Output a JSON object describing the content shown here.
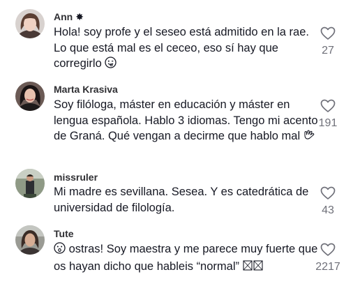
{
  "comments": [
    {
      "username": "Ann",
      "username_badge": "✸",
      "text": "Hola! soy profe y el seseo está admitido en la rae. Lo que está mal es el ceceo, eso sí hay que corregirlo",
      "trailing_emoji": "winking-face-tongue-emoji",
      "likes": "27"
    },
    {
      "username": "Marta Krasiva",
      "text": "Soy filóloga, máster en educación y máster en lengua española. Hablo 3 idiomas. Tengo mi acento de Graná. Qué vengan a decirme que hablo mal",
      "trailing_emoji": "open-hands-emoji",
      "likes": "191"
    },
    {
      "username": "missruler",
      "text": "Mi madre es sevillana. Sesea. Y es catedrática de universidad de filología.",
      "likes": "43"
    },
    {
      "username": "Tute",
      "leading_emoji": "hushed-face-emoji",
      "text": "ostras! Soy maestra y me parece muy fuerte que os hayan dicho que hableis “normal”",
      "trailing_emoji": "missing-glyph-boxes",
      "likes": "2217"
    }
  ],
  "colors": {
    "text": "#161823",
    "username": "#2f2f33",
    "like_count": "#6f7079",
    "heart_outline": "#6f7079"
  }
}
